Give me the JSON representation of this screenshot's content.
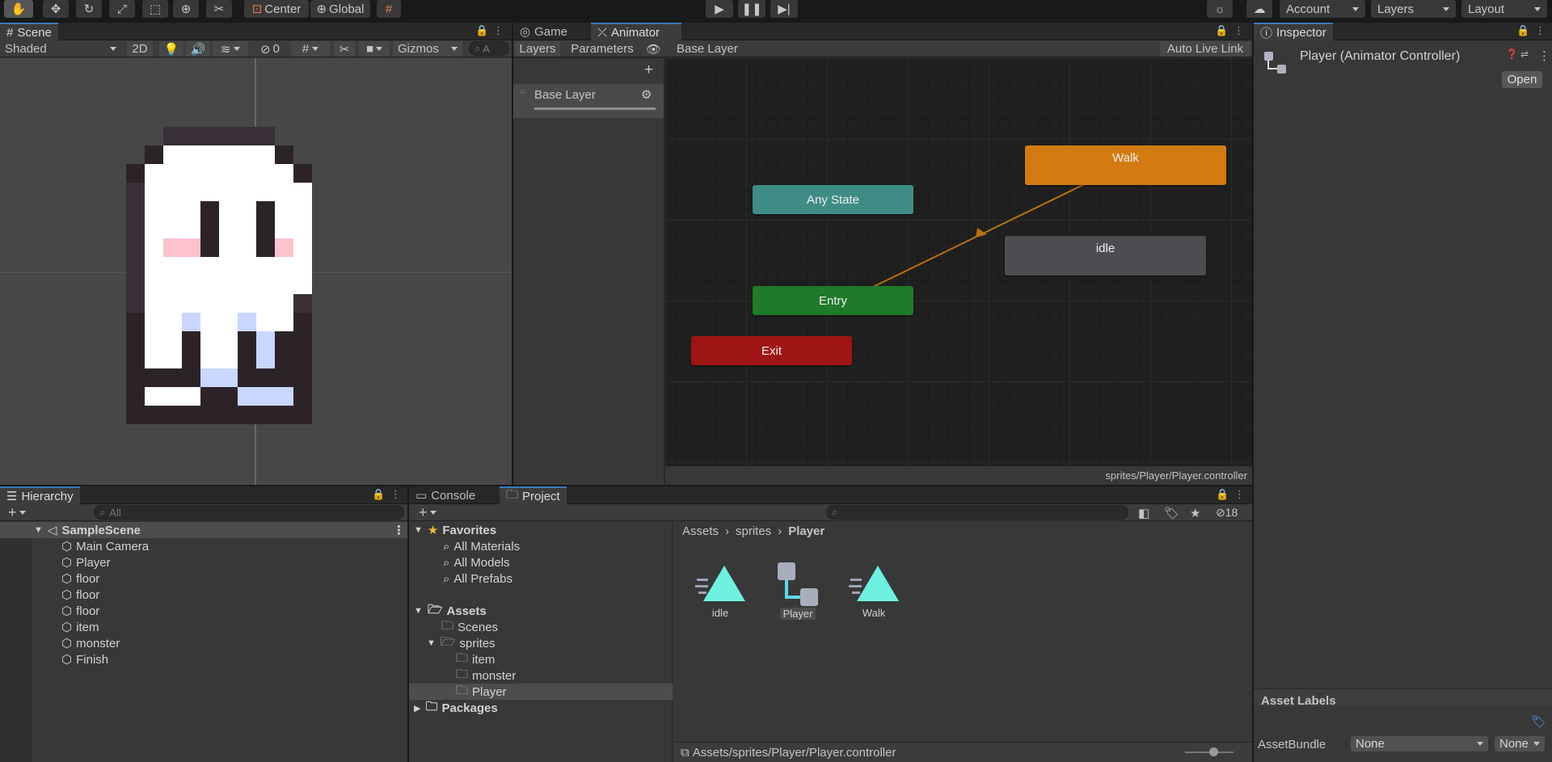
{
  "toolbar": {
    "pivot": "Center",
    "space": "Global",
    "account": "Account",
    "layers": "Layers",
    "layout": "Layout"
  },
  "scene": {
    "tab": "Scene",
    "shading": "Shaded",
    "mode2d": "2D",
    "hidden_count": "0",
    "gizmos": "Gizmos",
    "search_placeholder": "A"
  },
  "game_tab": "Game",
  "animator": {
    "tab": "Animator",
    "layers_tab": "Layers",
    "parameters_tab": "Parameters",
    "breadcrumb": "Base Layer",
    "auto_live_link": "Auto Live Link",
    "layer_name": "Base Layer",
    "states": {
      "walk": "Walk",
      "any_state": "Any State",
      "idle": "idle",
      "entry": "Entry",
      "exit": "Exit"
    },
    "status_path": "sprites/Player/Player.controller",
    "colors": {
      "walk": "#d37a10",
      "any_state": "#3f8c86",
      "idle": "#4c4d50",
      "entry": "#1f7a2b",
      "exit": "#9f1515",
      "transition": "#b8720f"
    }
  },
  "inspector": {
    "tab": "Inspector",
    "title": "Player (Animator Controller)",
    "open_button": "Open",
    "asset_labels": "Asset Labels",
    "asset_bundle_label": "AssetBundle",
    "asset_bundle_value": "None",
    "asset_variant_value": "None"
  },
  "hierarchy": {
    "tab": "Hierarchy",
    "search_placeholder": "All",
    "scene": "SampleScene",
    "objects": [
      "Main Camera",
      "Player",
      "floor",
      "floor",
      "floor",
      "item",
      "monster",
      "Finish"
    ]
  },
  "console_tab": "Console",
  "project": {
    "tab": "Project",
    "hidden_count": "18",
    "favorites": "Favorites",
    "favorite_items": [
      "All Materials",
      "All Models",
      "All Prefabs"
    ],
    "assets": "Assets",
    "folders": {
      "scenes": "Scenes",
      "sprites": "sprites",
      "item": "item",
      "monster": "monster",
      "player": "Player"
    },
    "packages": "Packages",
    "breadcrumb": [
      "Assets",
      "sprites",
      "Player"
    ],
    "files": [
      {
        "name": "idle",
        "icon": "animation-clip-icon"
      },
      {
        "name": "Player",
        "icon": "animator-controller-icon"
      },
      {
        "name": "Walk",
        "icon": "animation-clip-icon"
      }
    ],
    "footer_path": "Assets/sprites/Player/Player.controller"
  }
}
